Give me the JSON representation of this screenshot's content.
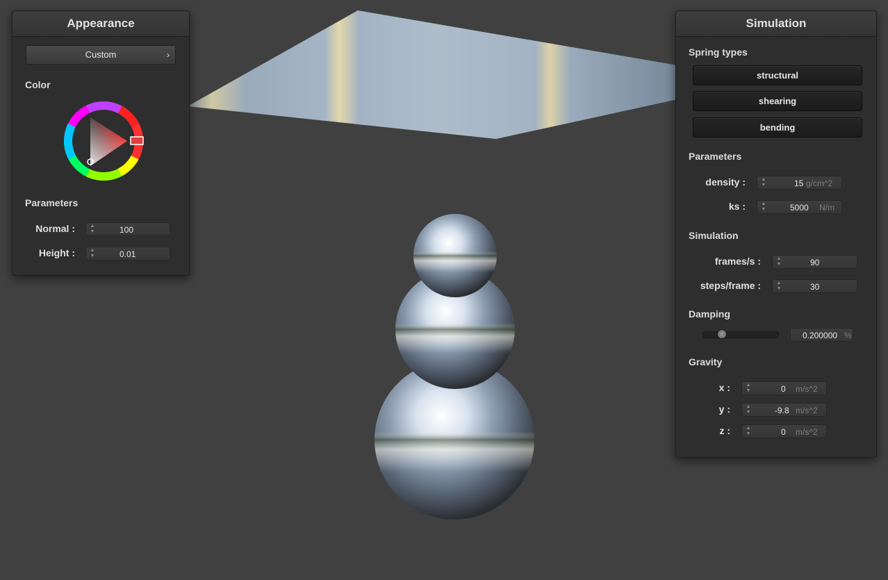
{
  "appearance": {
    "title": "Appearance",
    "preset_label": "Custom",
    "preset_chevron": "›",
    "color_section": "Color",
    "color": "#e02020",
    "parameters_section": "Parameters",
    "normal_label": "Normal :",
    "normal_value": "100",
    "height_label": "Height :",
    "height_value": "0.01"
  },
  "simulation": {
    "title": "Simulation",
    "spring_types_section": "Spring types",
    "spring_buttons": [
      "structural",
      "shearing",
      "bending"
    ],
    "parameters_section": "Parameters",
    "density_label": "density :",
    "density_value": "15",
    "density_unit": "g/cm^2",
    "ks_label": "ks :",
    "ks_value": "5000",
    "ks_unit": "N/m",
    "simulation_section": "Simulation",
    "fps_label": "frames/s :",
    "fps_value": "90",
    "steps_label": "steps/frame :",
    "steps_value": "30",
    "damping_section": "Damping",
    "damping_value": "0.200000",
    "damping_unit": "%",
    "damping_fraction": 0.2,
    "gravity_section": "Gravity",
    "gx_label": "x :",
    "gx_value": "0",
    "gy_label": "y :",
    "gy_value": "-9.8",
    "gz_label": "z :",
    "gz_value": "0",
    "gravity_unit": "m/s^2"
  },
  "icons": {
    "spin": "spinner-icon",
    "chevron": "chevron-right-icon"
  }
}
